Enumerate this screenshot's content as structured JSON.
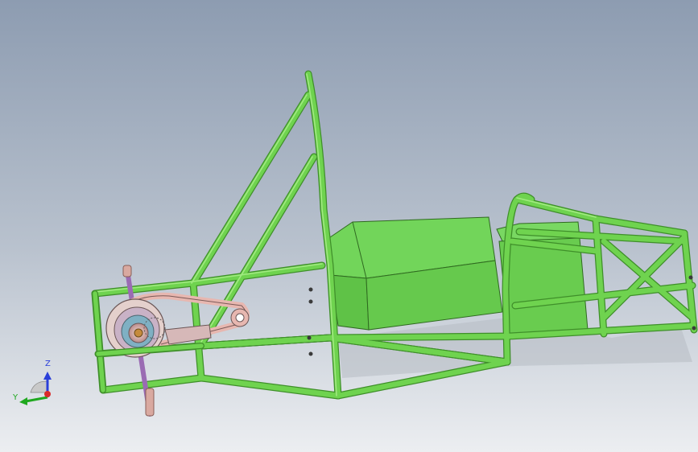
{
  "viewport": {
    "background_top": "#8d9cb1",
    "background_bottom": "#e9ebee"
  },
  "colors": {
    "frame_tube": "#6fd34f",
    "frame_tube_dark": "#3f8f2a",
    "frame_tube_light": "#a6ec86",
    "body_panel_top": "#6cd155",
    "body_panel_side": "#4ea836",
    "pulley_pink": "#e7b7b0",
    "axle_purple": "#9a6bb3",
    "axle_end": "#d9a9a0",
    "triad_z": "#2a3fd9",
    "triad_y": "#1fa81f",
    "triad_x": "#d92a2a"
  },
  "triad": {
    "z_label": "Z",
    "y_label": "Y",
    "icon": "coordinate-triad-icon"
  }
}
